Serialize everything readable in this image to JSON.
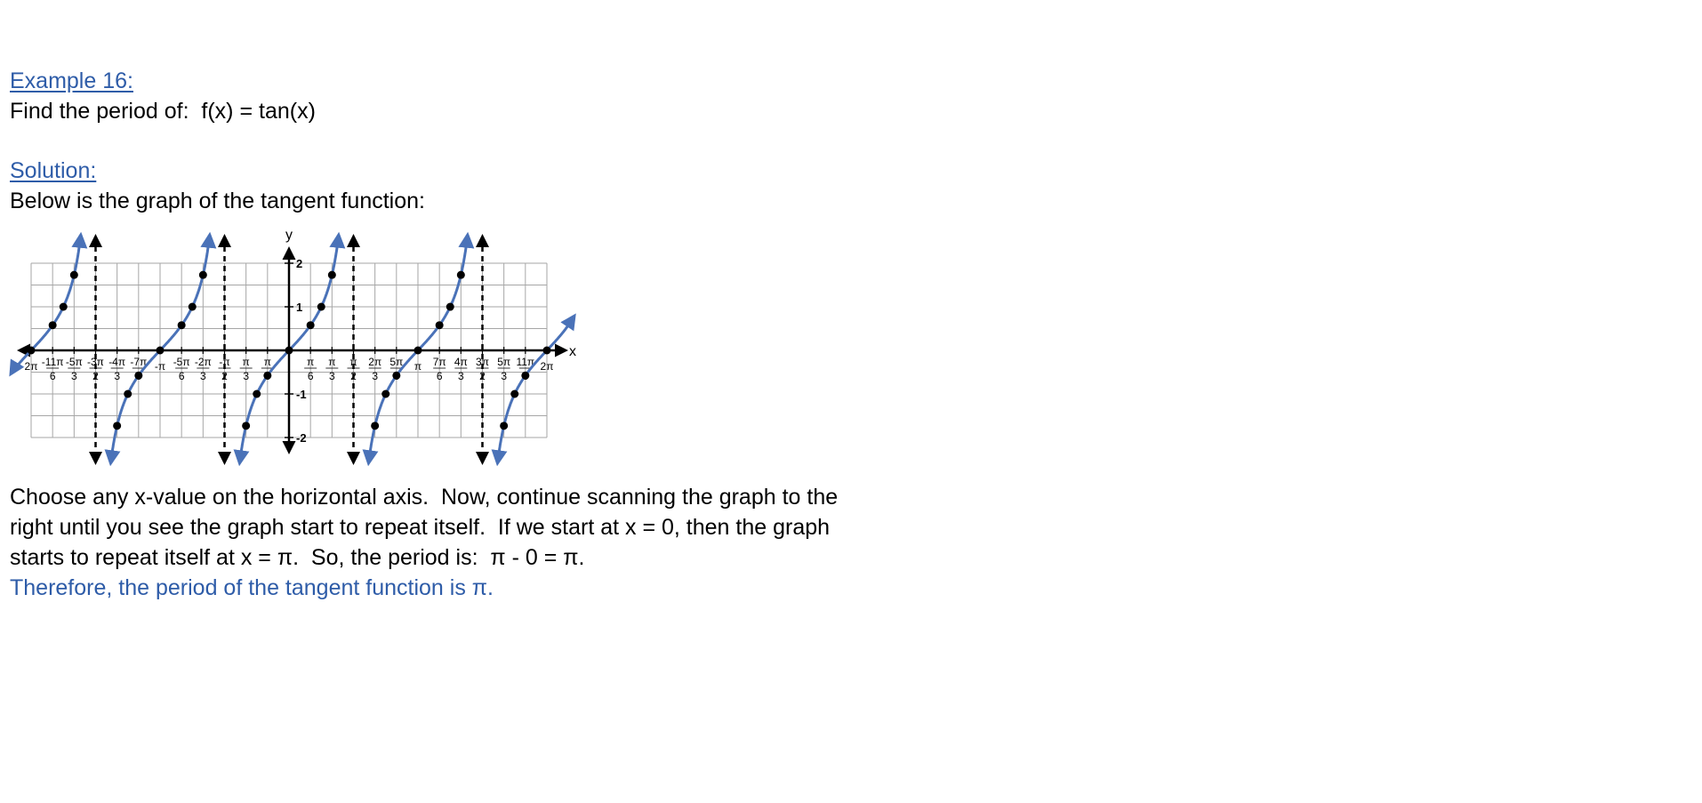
{
  "example": {
    "heading": "Example 16:",
    "problem": "Find the period of:  f(x) = tan(x)"
  },
  "solution": {
    "heading": "Solution:",
    "intro": "Below is the graph of the tangent function:",
    "body_lines": [
      "Choose any x-value on the horizontal axis.  Now, continue scanning the graph to the",
      "right until you see the graph start to repeat itself.  If we start at x = 0, then the graph",
      "starts to repeat itself at x = π.  So, the period is:  π - 0 = π."
    ],
    "conclusion": "Therefore, the period of the tangent function is π."
  },
  "colors": {
    "accent": "#2E5CA8",
    "curve": "#4A72B8",
    "grid": "#a6a6a6"
  },
  "chart_data": {
    "type": "line",
    "function": "tan(x)",
    "xlabel": "x",
    "ylabel": "y",
    "xlim": [
      "-2π",
      "2π"
    ],
    "ylim": [
      -2,
      2
    ],
    "y_ticks": [
      {
        "value": 2,
        "label": "2"
      },
      {
        "value": 1,
        "label": "1"
      },
      {
        "value": -1,
        "label": "-1"
      },
      {
        "value": -2,
        "label": "-2"
      }
    ],
    "x_ticks": [
      {
        "value": -6.2832,
        "label": "2π",
        "den": ""
      },
      {
        "value": -5.7596,
        "label": "-11π",
        "den": "6"
      },
      {
        "value": -5.236,
        "label": "-5π",
        "den": "3"
      },
      {
        "value": -4.7124,
        "label": "-3π",
        "den": "2"
      },
      {
        "value": -4.1888,
        "label": "-4π",
        "den": "3"
      },
      {
        "value": -3.6652,
        "label": "-7π",
        "den": "6"
      },
      {
        "value": -3.1416,
        "label": "-π",
        "den": ""
      },
      {
        "value": -2.618,
        "label": "-5π",
        "den": "6"
      },
      {
        "value": -2.0944,
        "label": "-2π",
        "den": "3"
      },
      {
        "value": -1.5708,
        "label": "-π",
        "den": "2"
      },
      {
        "value": -1.0472,
        "label": "π",
        "den": "3"
      },
      {
        "value": -0.5236,
        "label": "π",
        "den": "6"
      },
      {
        "value": 0.5236,
        "label": "π",
        "den": "6"
      },
      {
        "value": 1.0472,
        "label": "π",
        "den": "3"
      },
      {
        "value": 1.5708,
        "label": "π",
        "den": "2"
      },
      {
        "value": 2.0944,
        "label": "2π",
        "den": "3"
      },
      {
        "value": 2.618,
        "label": "5π",
        "den": "6"
      },
      {
        "value": 3.1416,
        "label": "π",
        "den": ""
      },
      {
        "value": 3.6652,
        "label": "7π",
        "den": "6"
      },
      {
        "value": 4.1888,
        "label": "4π",
        "den": "3"
      },
      {
        "value": 4.7124,
        "label": "3π",
        "den": "2"
      },
      {
        "value": 5.236,
        "label": "5π",
        "den": "3"
      },
      {
        "value": 5.7596,
        "label": "11π",
        "den": "6"
      },
      {
        "value": 6.2832,
        "label": "2π",
        "den": ""
      }
    ],
    "asymptotes": [
      -4.7124,
      -1.5708,
      1.5708,
      4.7124
    ],
    "branches": [
      [
        -7.85398,
        -4.71239
      ],
      [
        -4.71239,
        -1.5708
      ],
      [
        -1.5708,
        1.5708
      ],
      [
        1.5708,
        4.71239
      ],
      [
        4.71239,
        7.85398
      ]
    ],
    "points": [
      {
        "x": -6.2832,
        "y": 0
      },
      {
        "x": -5.7596,
        "y": 0.577
      },
      {
        "x": -5.4978,
        "y": 1
      },
      {
        "x": -5.236,
        "y": 1.732
      },
      {
        "x": -4.1888,
        "y": -1.732
      },
      {
        "x": -3.927,
        "y": -1
      },
      {
        "x": -3.6652,
        "y": -0.577
      },
      {
        "x": -3.1416,
        "y": 0
      },
      {
        "x": -2.618,
        "y": 0.577
      },
      {
        "x": -2.3562,
        "y": 1
      },
      {
        "x": -2.0944,
        "y": 1.732
      },
      {
        "x": -1.0472,
        "y": -1.732
      },
      {
        "x": -0.7854,
        "y": -1
      },
      {
        "x": -0.5236,
        "y": -0.577
      },
      {
        "x": 0,
        "y": 0
      },
      {
        "x": 0.5236,
        "y": 0.577
      },
      {
        "x": 0.7854,
        "y": 1
      },
      {
        "x": 1.0472,
        "y": 1.732
      },
      {
        "x": 2.0944,
        "y": -1.732
      },
      {
        "x": 2.3562,
        "y": -1
      },
      {
        "x": 2.618,
        "y": -0.577
      },
      {
        "x": 3.1416,
        "y": 0
      },
      {
        "x": 3.6652,
        "y": 0.577
      },
      {
        "x": 3.927,
        "y": 1
      },
      {
        "x": 4.1888,
        "y": 1.732
      },
      {
        "x": 5.236,
        "y": -1.732
      },
      {
        "x": 5.4978,
        "y": -1
      },
      {
        "x": 5.7596,
        "y": -0.577
      },
      {
        "x": 6.2832,
        "y": 0
      }
    ]
  }
}
